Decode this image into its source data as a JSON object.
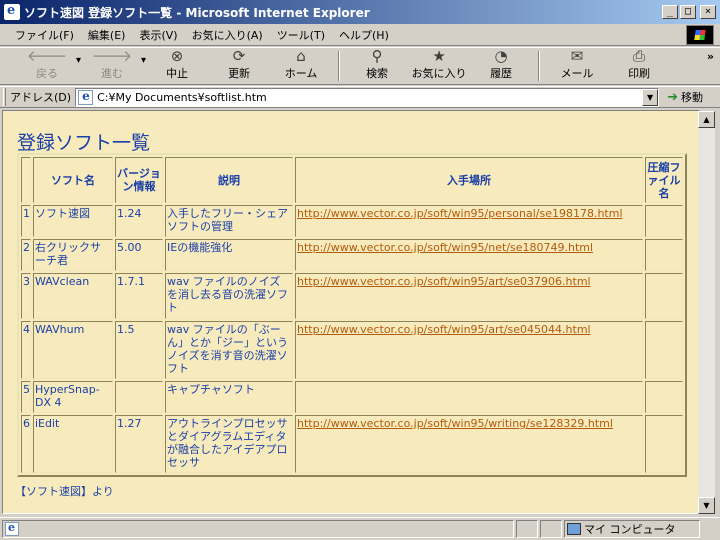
{
  "window": {
    "title": "ソフト速図 登録ソフト一覧 - Microsoft Internet Explorer",
    "buttons": [
      "_",
      "□",
      "×"
    ]
  },
  "menubar": {
    "items": [
      "ファイル(F)",
      "編集(E)",
      "表示(V)",
      "お気に入り(A)",
      "ツール(T)",
      "ヘルプ(H)"
    ]
  },
  "toolbar": {
    "buttons": [
      {
        "label": "戻る",
        "icon": "back-arrow-icon",
        "enabled": false
      },
      {
        "label": "進む",
        "icon": "forward-arrow-icon",
        "enabled": false
      },
      {
        "label": "中止",
        "icon": "stop-icon",
        "enabled": true
      },
      {
        "label": "更新",
        "icon": "refresh-icon",
        "enabled": true
      },
      {
        "label": "ホーム",
        "icon": "home-icon",
        "enabled": true
      },
      {
        "label": "検索",
        "icon": "search-icon",
        "enabled": true
      },
      {
        "label": "お気に入り",
        "icon": "favorites-icon",
        "enabled": true
      },
      {
        "label": "履歴",
        "icon": "history-icon",
        "enabled": true
      },
      {
        "label": "メール",
        "icon": "mail-icon",
        "enabled": true
      },
      {
        "label": "印刷",
        "icon": "print-icon",
        "enabled": true
      }
    ],
    "more": "»"
  },
  "addressbar": {
    "label": "アドレス(D)",
    "value": "C:¥My Documents¥softlist.htm",
    "go_label": "移動"
  },
  "page": {
    "heading": "登録ソフト一覧",
    "columns": [
      "",
      "ソフト名",
      "バージョン情報",
      "説明",
      "入手場所",
      "圧縮ファイル名"
    ],
    "rows": [
      {
        "no": "1",
        "name": "ソフト速図",
        "version": "1.24",
        "desc": "入手したフリー・シェアソフトの管理",
        "url": "http://www.vector.co.jp/soft/win95/personal/se198178.html",
        "file": ""
      },
      {
        "no": "2",
        "name": "右クリックサーチ君",
        "version": "5.00",
        "desc": "IEの機能強化",
        "url": "http://www.vector.co.jp/soft/win95/net/se180749.html",
        "file": ""
      },
      {
        "no": "3",
        "name": "WAVclean",
        "version": "1.7.1",
        "desc": "wav ファイルのノイズを消し去る音の洗濯ソフト",
        "url": "http://www.vector.co.jp/soft/win95/art/se037906.html",
        "file": ""
      },
      {
        "no": "4",
        "name": "WAVhum",
        "version": "1.5",
        "desc": "wav ファイルの「ぶーん」とか「ジー」というノイズを消す音の洗濯ソフト",
        "url": "http://www.vector.co.jp/soft/win95/art/se045044.html",
        "file": ""
      },
      {
        "no": "5",
        "name": "HyperSnap-DX 4",
        "version": "",
        "desc": "キャプチャソフト",
        "url": "",
        "file": ""
      },
      {
        "no": "6",
        "name": "iEdit",
        "version": "1.27",
        "desc": "アウトラインプロセッサとダイアグラムエディタが融合したアイデアプロセッサ",
        "url": "http://www.vector.co.jp/soft/win95/writing/se128329.html",
        "file": ""
      }
    ],
    "footer": "【ソフト速図】より"
  },
  "statusbar": {
    "zone": "マイ コンピュータ"
  },
  "colors": {
    "page_bg": "#f7ebbd",
    "text_blue": "#1a3fa8",
    "link_orange": "#b45a0c",
    "titlebar_start": "#0a246a",
    "titlebar_end": "#a6caf0"
  }
}
